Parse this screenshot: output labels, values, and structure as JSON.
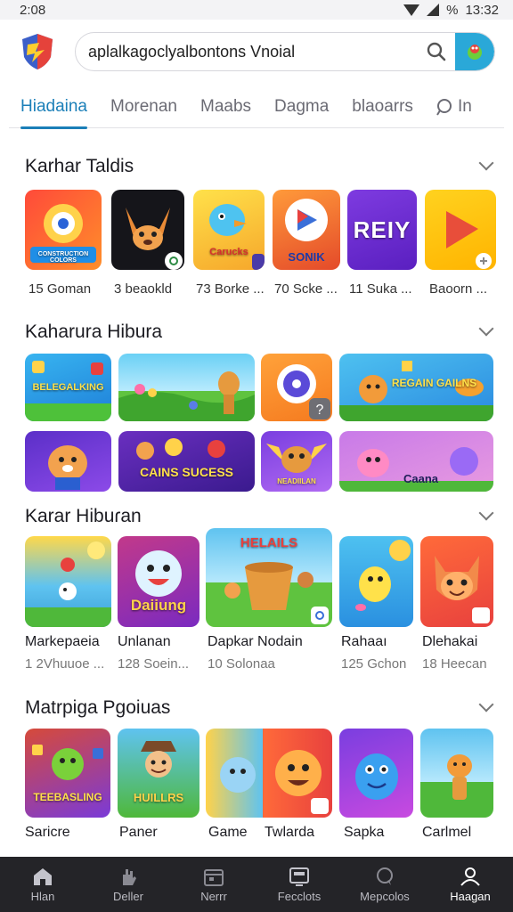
{
  "status": {
    "time": "2:08",
    "battery_text": "%",
    "clock_right": "13:32"
  },
  "search": {
    "query": "aplalkagoclyalbontons Vnoial"
  },
  "tabs": [
    {
      "label": "Hiadaina"
    },
    {
      "label": "Morenan"
    },
    {
      "label": "Maabs"
    },
    {
      "label": "Dagma"
    },
    {
      "label": "blaoarrs"
    },
    {
      "label": "In"
    }
  ],
  "sections": [
    {
      "title": "Karhar Taldis",
      "items": [
        {
          "art": "CONSTRUCTION COLORS",
          "caption": "15 Goman"
        },
        {
          "art": "",
          "caption": "3 beaokld"
        },
        {
          "art": "Carucks",
          "caption": "73 Borke ..."
        },
        {
          "art": "SONIK",
          "caption": "70 Scke ..."
        },
        {
          "art": "REIY",
          "caption": "11 Suka ..."
        },
        {
          "art": "",
          "caption": "Baoorn ..."
        }
      ]
    },
    {
      "title": "Kaharura Hibura",
      "items": [
        {
          "art": "BELEGALKING"
        },
        {
          "art": ""
        },
        {
          "art": ""
        },
        {
          "art": "REGAIN GAILNS"
        },
        {
          "art": ""
        },
        {
          "art": "CAINS SUCESS"
        },
        {
          "art": "NEADIILAN"
        },
        {
          "art": "Caana"
        }
      ]
    },
    {
      "title": "Karar Hibuɾan",
      "items": [
        {
          "art": "",
          "name": "Markepaeia",
          "sub": "1 2Vhuuoe ..."
        },
        {
          "art": "Daiiung",
          "name": "Unlanan",
          "sub": "128 Soein..."
        },
        {
          "art": "HELAILS",
          "name": "Dapkar Nodain",
          "sub": "10 Solonaa"
        },
        {
          "art": "",
          "name": "Rahaaı",
          "sub": "125 Gchon"
        },
        {
          "art": "",
          "name": "Dlehakai",
          "sub": "18 Heecan"
        }
      ]
    },
    {
      "title": "Matrpiga Pgoiuas",
      "items": [
        {
          "art": "TEEBASLING",
          "name": "Saricre"
        },
        {
          "art": "HUILLRS",
          "name": "Paner"
        },
        {
          "art": "",
          "name": "Game"
        },
        {
          "art": "",
          "name": "Twlarda"
        },
        {
          "art": "",
          "name": "Sapka"
        },
        {
          "art": "",
          "name": "Carlmel"
        }
      ]
    }
  ],
  "nav": [
    {
      "label": "Hlan",
      "icon": "home-icon"
    },
    {
      "label": "Deller",
      "icon": "hand-icon"
    },
    {
      "label": "Nerrr",
      "icon": "calendar-icon"
    },
    {
      "label": "Fecclots",
      "icon": "tv-icon"
    },
    {
      "label": "Mepcolos",
      "icon": "chat-icon"
    },
    {
      "label": "Haagan",
      "icon": "profile-icon"
    }
  ],
  "colors": {
    "accent": "#1b7fb8",
    "mic_bg": "#2aa8d8",
    "nav_bg": "#242428"
  }
}
